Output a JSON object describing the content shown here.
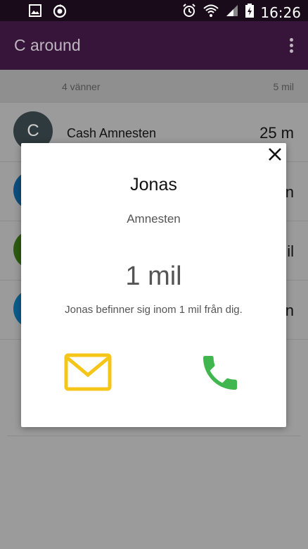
{
  "status_bar": {
    "time": "16:26",
    "icons": [
      "image-icon",
      "sync-icon",
      "alarm-icon",
      "wifi-icon",
      "signal-icon",
      "battery-charging-icon"
    ]
  },
  "app_bar": {
    "title": "C around",
    "overflow_icon": "more-vert-icon"
  },
  "summary": {
    "friends_count": "4 vänner",
    "range": "5 mil"
  },
  "list": {
    "items": [
      {
        "initial": "C",
        "name": "Cash Amnesten",
        "distance": "25 m",
        "avatar_color": "#2e3a3d"
      },
      {
        "initial": "",
        "name": "",
        "distance": "n",
        "avatar_color": "#0b4f80"
      },
      {
        "initial": "",
        "name": "",
        "distance": "il",
        "avatar_color": "#2e5a12"
      },
      {
        "initial": "",
        "name": "",
        "distance": "n",
        "avatar_color": "#0b5d8a"
      }
    ]
  },
  "dialog": {
    "name": "Jonas",
    "surname": "Amnesten",
    "distance": "1 mil",
    "message": "Jonas befinner sig inom 1 mil från dig.",
    "close_icon": "close-icon",
    "mail_icon": "mail-icon",
    "phone_icon": "phone-icon",
    "mail_color": "#f5c518",
    "phone_color": "#3fb74e"
  }
}
